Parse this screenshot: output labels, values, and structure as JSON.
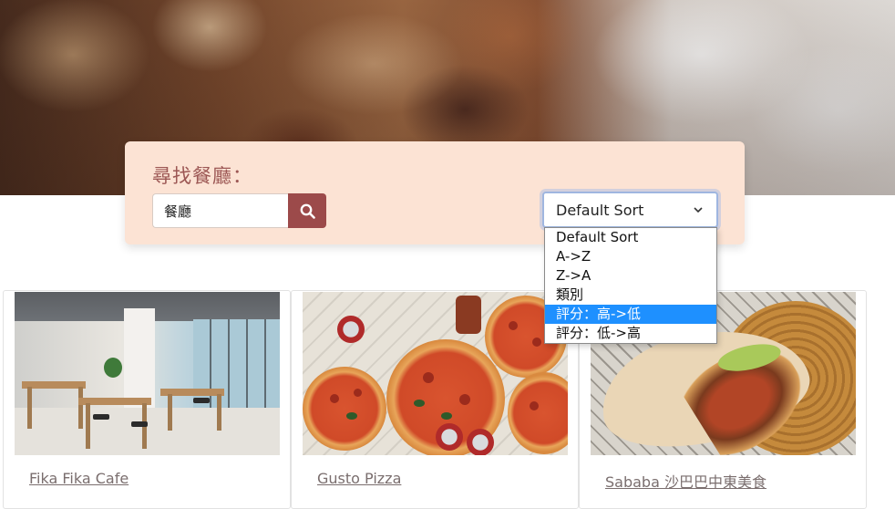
{
  "hero": {
    "description_icon": "restaurant-background"
  },
  "search": {
    "title": "尋找餐廳：",
    "input_value": "餐廳",
    "button_icon": "search-icon"
  },
  "sort": {
    "selected": "Default Sort",
    "options": [
      {
        "label": "Default Sort",
        "highlighted": false
      },
      {
        "label": "A->Z",
        "highlighted": false
      },
      {
        "label": "Z->A",
        "highlighted": false
      },
      {
        "label": "類別",
        "highlighted": false
      },
      {
        "label": "評分：高->低",
        "highlighted": true
      },
      {
        "label": "評分：低->高",
        "highlighted": false
      }
    ]
  },
  "restaurants": [
    {
      "name": "Fika Fika Cafe",
      "image_icon": "cafe-photo"
    },
    {
      "name": "Gusto Pizza",
      "image_icon": "pizza-photo"
    },
    {
      "name": "Sababa 沙巴巴中東美食",
      "image_icon": "pita-photo"
    }
  ],
  "colors": {
    "panel_bg": "#fce3d4",
    "accent": "#9c4a4a",
    "title_text": "#9c5754",
    "dropdown_highlight": "#1e90ff"
  }
}
